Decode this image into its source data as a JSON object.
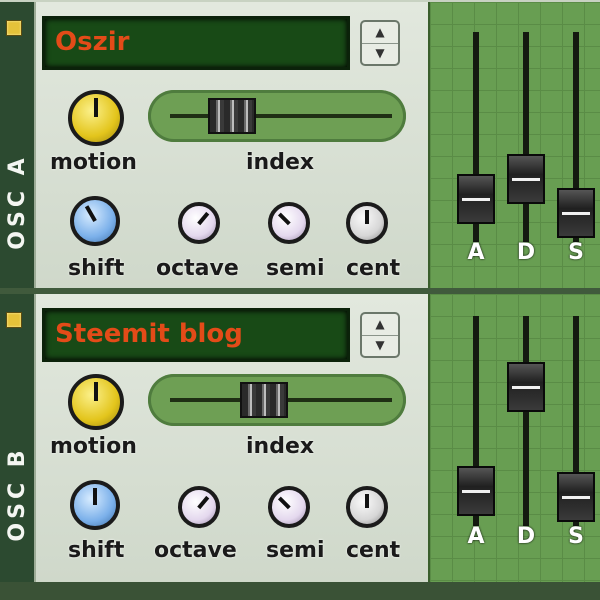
{
  "oscA": {
    "strip_label": "OSC A",
    "display_text": "Oszir",
    "labels": {
      "motion": "motion",
      "index": "index",
      "shift": "shift",
      "octave": "octave",
      "semi": "semi",
      "cent": "cent"
    },
    "adsr": [
      "A",
      "D",
      "S"
    ]
  },
  "oscB": {
    "strip_label": "OSC B",
    "display_text": "Steemit blog",
    "labels": {
      "motion": "motion",
      "index": "index",
      "shift": "shift",
      "octave": "octave",
      "semi": "semi",
      "cent": "cent"
    },
    "adsr": [
      "A",
      "D",
      "S"
    ]
  },
  "icons": {
    "up": "triangle-up",
    "down": "triangle-down",
    "led": "square-led"
  },
  "colors": {
    "display_text": "#e34b18",
    "display_bg": "#184a16",
    "adsr_bg": "#689e52",
    "motion_knob": "#e3c51c",
    "shift_knob": "#7bb0ea"
  }
}
